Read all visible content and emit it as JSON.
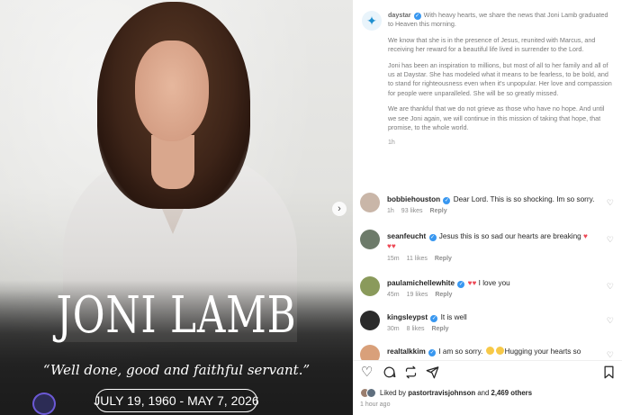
{
  "post": {
    "image": {
      "name": "JONI LAMB",
      "quote": "“Well done, good and faithful servant.”",
      "dates": "JULY 19, 1960 - MAY 7, 2026"
    },
    "caption": {
      "username": "daystar",
      "p1": "With heavy hearts, we share the news that Joni Lamb graduated to Heaven this morning.",
      "p2": "We know that she is in the presence of Jesus, reunited with Marcus, and receiving her reward for a beautiful life lived in surrender to the Lord.",
      "p3": "Joni has been an inspiration to millions, but most of all to her family and all of us at Daystar. She has modeled what it means to be fearless, to be bold, and to stand for righteousness even when it's unpopular. Her love and compassion for people were unparalleled. She will be so greatly missed.",
      "p4": "We are thankful that we do not grieve as those who have no hope. And until we see Joni again, we will continue in this mission of taking that hope, that promise, to the whole world.",
      "time": "1h"
    },
    "comments": [
      {
        "user": "bobbiehouston",
        "text": "Dear Lord. This is so shocking. Im so sorry.",
        "time": "1h",
        "likes": "93 likes",
        "reply": "Reply",
        "avatar_color": "#c9b6a8"
      },
      {
        "user": "seanfeucht",
        "text": "Jesus this is so sad our hearts are breaking",
        "time": "15m",
        "likes": "11 likes",
        "reply": "Reply",
        "avatar_color": "#6d7b6a"
      },
      {
        "user": "paulamichellewhite",
        "text": "I love you",
        "time": "45m",
        "likes": "19 likes",
        "reply": "Reply",
        "avatar_color": "#8a9a5b"
      },
      {
        "user": "kingsleypst",
        "text": "It is well",
        "time": "30m",
        "likes": "8 likes",
        "reply": "Reply",
        "avatar_color": "#2b2b2b"
      },
      {
        "user": "realtalkkim",
        "text": "I am so sorry.",
        "text2": "Hugging your hearts so",
        "time": "",
        "likes": "",
        "reply": "",
        "avatar_color": "#d9a07a"
      }
    ],
    "likes": {
      "prefix": "Liked by",
      "user": "pastortravisjohnson",
      "connector": "and",
      "count": "2,469 others"
    },
    "posted_ago": "1 hour ago"
  }
}
